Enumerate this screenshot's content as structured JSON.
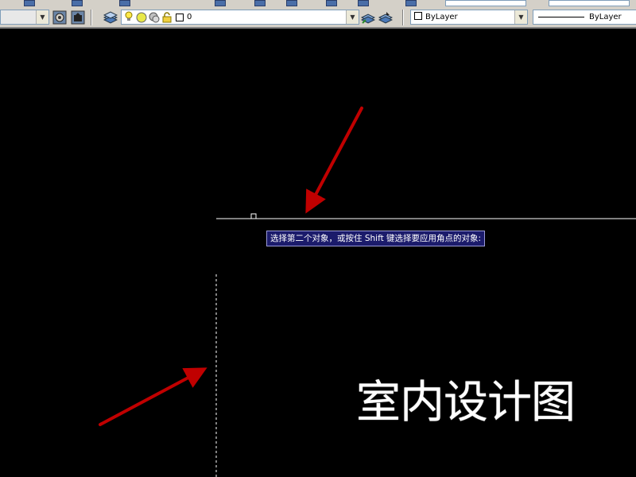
{
  "toolbar": {
    "workspace_combo_value": "",
    "layer_value": "0",
    "color_value": "ByLayer",
    "linetype_value": "ByLayer",
    "icons": [
      "layer-manager-icon",
      "light-bulb-icon",
      "sun-icon",
      "freeze-icon",
      "lock-icon",
      "layer-color-swatch-icon",
      "make-current-layer-icon",
      "layer-previous-icon",
      "gear-icon",
      "camera-icon"
    ]
  },
  "canvas": {
    "tooltip_text": "选择第二个对象，或按住 Shift 键选择要应用角点的对象:",
    "big_text": "室内设计图"
  },
  "colors": {
    "background": "#000000",
    "arrow": "#c00000",
    "tooltip_bg": "#1b1b6b",
    "line": "#ffffff"
  }
}
